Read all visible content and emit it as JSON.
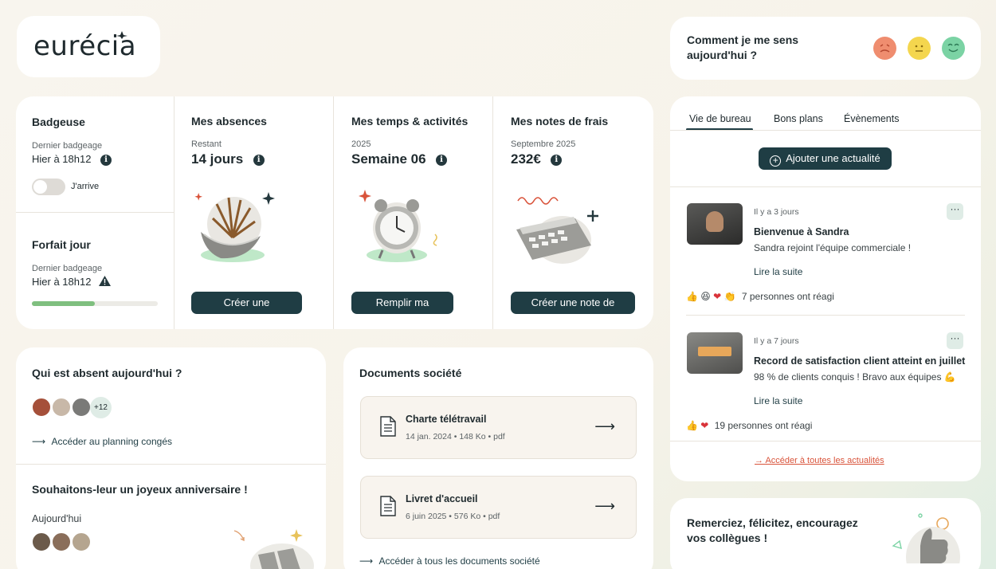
{
  "brand": {
    "logo_text": "eurécia"
  },
  "mood": {
    "question": "Comment je me sens aujourd'hui ?",
    "faces": [
      "sad-face-icon",
      "neutral-face-icon",
      "happy-face-icon"
    ],
    "face_colors": [
      "#ef8d6f",
      "#f4d64e",
      "#7bd3a4"
    ]
  },
  "badgeuse": {
    "title": "Badgeuse",
    "last_label": "Dernier badgeage",
    "last_value": "Hier à 18h12",
    "toggle_label": "J'arrive"
  },
  "forfait": {
    "title": "Forfait jour",
    "last_label": "Dernier badgeage",
    "last_value": "Hier à 18h12",
    "progress": 0.5
  },
  "absences": {
    "title": "Mes absences",
    "sub": "Restant",
    "value": "14 jours",
    "button": "Créer une demande"
  },
  "temps": {
    "title": "Mes temps & activités",
    "sub": "2025",
    "value": "Semaine 06",
    "button": "Remplir ma feuille"
  },
  "frais": {
    "title": "Mes notes de frais",
    "sub": "Septembre 2025",
    "value": "232€",
    "button": "Créer une note de frais"
  },
  "absent_today": {
    "title": "Qui est absent aujourd'hui ?",
    "more_count": "+12",
    "link": "Accéder au planning congés"
  },
  "birthday": {
    "title": "Souhaitons-leur un joyeux anniversaire !",
    "today_label": "Aujourd'hui"
  },
  "documents": {
    "title": "Documents société",
    "items": [
      {
        "title": "Charte télétravail",
        "date": "14 jan. 2024",
        "size": "148 Ko",
        "type": "pdf"
      },
      {
        "title": "Livret d'accueil",
        "date": "6 juin 2025",
        "size": "576 Ko",
        "type": "pdf"
      }
    ],
    "link": "Accéder à tous les documents société"
  },
  "news": {
    "tabs": [
      "Vie de bureau",
      "Bons plans",
      "Évènements"
    ],
    "active_tab": 0,
    "add_button": "Ajouter une actualité",
    "posts": [
      {
        "time": "Il y a 3 jours",
        "title": "Bienvenue à Sandra",
        "text": "Sandra rejoint l'équipe commerciale !",
        "read_more": "Lire la suite",
        "reactions": "7 personnes ont réagi"
      },
      {
        "time": "Il y a 7 jours",
        "title": "Record de satisfaction client atteint en juillet",
        "text": "98 % de clients conquis ! Bravo aux équipes 💪",
        "read_more": "Lire la suite",
        "reactions": "19 personnes ont réagi"
      }
    ],
    "all_link": "Accéder à toutes les actualités"
  },
  "kudos": {
    "title": "Remerciez, félicitez, encouragez vos collègues !"
  },
  "colors": {
    "primary_dark": "#1f3d44",
    "link_red": "#d9533a",
    "progress": "#7fbf7f"
  }
}
